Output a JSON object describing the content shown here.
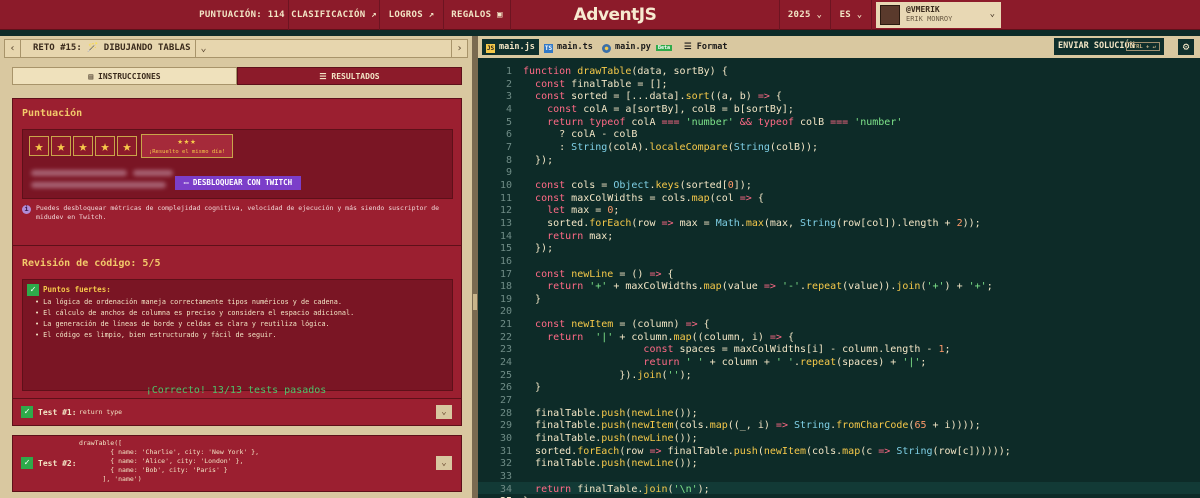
{
  "topbar": {
    "score": "PUNTUACIÓN: 114",
    "ranking": "CLASIFICACIÓN ↗",
    "achievements": "LOGROS ↗",
    "gifts": "REGALOS",
    "logo": "AdventJS",
    "year": "2025",
    "language": "ES",
    "user_handle": "@VMERIK",
    "user_name": "ERIK MONROY"
  },
  "challenge": {
    "title": "RETO #15: 🪄 DIBUJANDO TABLAS"
  },
  "tabs": {
    "instructions": "INSTRUCCIONES",
    "results": "RESULTADOS"
  },
  "score_card": {
    "heading": "Puntuación",
    "stars": 5,
    "bonus_stars": "★★★",
    "bonus_label": "¡Resuelto el mismo día!",
    "twitch_button": "DESBLOQUEAR CON TWITCH",
    "info": "Puedes desbloquear métricas de complejidad cognitiva, velocidad de ejecución y más siendo suscriptor de midudev en Twitch."
  },
  "review_card": {
    "heading": "Revisión de código: 5/5",
    "strong_points_heading": "Puntos fuertes:",
    "points": [
      "• La lógica de ordenación maneja correctamente tipos numéricos y de cadena.",
      "• El cálculo de anchos de columna es preciso y considera el espacio adicional.",
      "• La generación de líneas de borde y celdas es clara y reutiliza lógica.",
      "• El código es limpio, bien estructurado y fácil de seguir."
    ]
  },
  "tests": {
    "summary": "¡Correcto! 13/13 tests pasados",
    "items": [
      {
        "label": "Test #1:",
        "code": "return type"
      },
      {
        "label": "Test #2:",
        "code": "drawTable([\n        { name: 'Charlie', city: 'New York' },\n        { name: 'Alice', city: 'London' },\n        { name: 'Bob', city: 'Paris' }\n      ], 'name')"
      }
    ]
  },
  "editor": {
    "files": [
      "main.js",
      "main.ts",
      "main.py"
    ],
    "py_badge": "Beta",
    "format": "Format",
    "submit": "ENVIAR SOLUCIÓN",
    "submit_shortcut": "CTRL + ↵",
    "line_count": 35,
    "current_line": 35
  },
  "colors": {
    "topbar": "#8c1b2a",
    "panel_bg": "#d9c8a0",
    "card": "#9b1f30",
    "editor_bg": "#0d2b28",
    "accent_yellow": "#f6c94a",
    "success": "#4ec26a",
    "twitch": "#7b3ec9"
  }
}
